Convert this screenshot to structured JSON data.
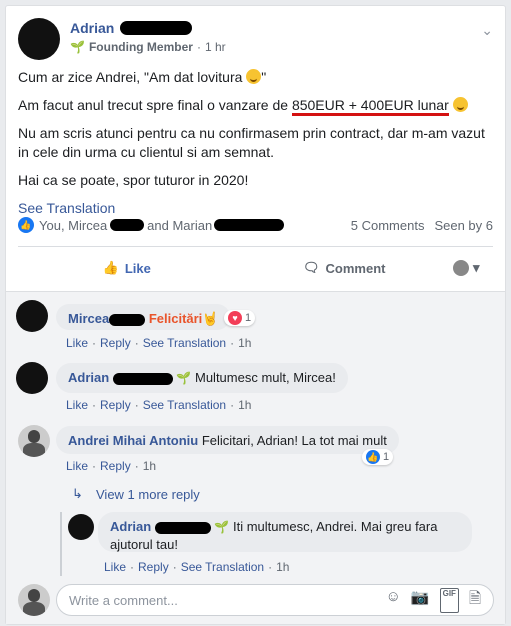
{
  "post": {
    "author": "Adrian",
    "badge": "Founding Member",
    "time": "1 hr",
    "line1": "Cum ar zice Andrei, \"Am dat lovitura",
    "line1_end": "\"",
    "line2_pre": "Am facut anul trecut spre final o vanzare de ",
    "line2_highlight": "850EUR + 400EUR lunar",
    "line3": "Nu am scris atunci pentru ca nu confirmasem prin contract, dar m-am vazut in cele din urma cu clientul si am semnat.",
    "line4": "Hai ca se poate, spor tuturor in 2020!",
    "see_translation": "See Translation"
  },
  "reactions": {
    "people_pre": "You, Mircea",
    "people_mid": "and Marian",
    "comments_count": "5 Comments",
    "seen_by": "Seen by 6"
  },
  "actions": {
    "like": "Like",
    "comment": "Comment"
  },
  "comments": [
    {
      "name": "Mircea",
      "text": "Felicitări",
      "reaction_count": "1",
      "links": [
        "Like",
        "Reply",
        "See Translation"
      ],
      "time": "1h"
    },
    {
      "name": "Adrian",
      "text": "Multumesc mult, Mircea!",
      "links": [
        "Like",
        "Reply",
        "See Translation"
      ],
      "time": "1h"
    },
    {
      "name": "Andrei Mihai Antoniu",
      "text": "Felicitari, Adrian! La tot mai mult",
      "reaction_count": "1",
      "links": [
        "Like",
        "Reply"
      ],
      "time": "1h"
    }
  ],
  "view_more": "View 1 more reply",
  "reply": {
    "name": "Adrian",
    "text": "Iti multumesc, Andrei. Mai greu fara ajutorul tau!",
    "links": [
      "Like",
      "Reply",
      "See Translation"
    ],
    "time": "1h"
  },
  "composer": {
    "placeholder": "Write a comment..."
  }
}
